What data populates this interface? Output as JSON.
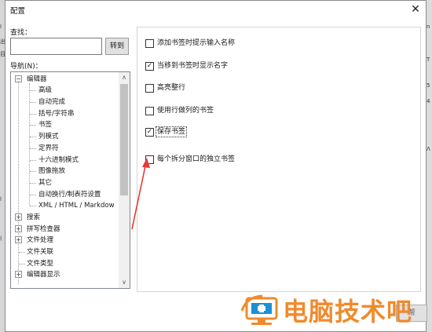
{
  "left_edge_fragments": [
    "Ⅰ",
    "出",
    "目",
    "l",
    "("
  ],
  "right_edge_fragments": [
    "n",
    "T",
    "5",
    "4",
    "ᐱ"
  ],
  "dialog": {
    "title": "配置",
    "close_glyph": "✕"
  },
  "find": {
    "label": "查找：",
    "value": "",
    "goto_label": "转到"
  },
  "nav": {
    "label": "导航(N)：",
    "items": [
      {
        "label": "编辑器",
        "level": 0,
        "expander": "−"
      },
      {
        "label": "高级",
        "level": 1
      },
      {
        "label": "自动完成",
        "level": 1
      },
      {
        "label": "括号/字符串",
        "level": 1
      },
      {
        "label": "书签",
        "level": 1
      },
      {
        "label": "列模式",
        "level": 1
      },
      {
        "label": "定界符",
        "level": 1
      },
      {
        "label": "十六进制模式",
        "level": 1
      },
      {
        "label": "图像拖放",
        "level": 1
      },
      {
        "label": "其它",
        "level": 1
      },
      {
        "label": "自动换行/制表符设置",
        "level": 1
      },
      {
        "label": "XML / HTML / Markdow",
        "level": 1
      },
      {
        "label": "搜索",
        "level": 0,
        "expander": "+"
      },
      {
        "label": "拼写检查器",
        "level": 0,
        "expander": "+"
      },
      {
        "label": "文件处理",
        "level": 0,
        "expander": "+"
      },
      {
        "label": "文件关联",
        "level": 0
      },
      {
        "label": "文件类型",
        "level": 0
      },
      {
        "label": "编辑器显示",
        "level": 0,
        "expander": "+"
      }
    ],
    "scroll_up_glyph": "∧",
    "scroll_down_glyph": "∨"
  },
  "options": [
    {
      "label": "添加书签时提示输入名称",
      "checked": false
    },
    {
      "label": "当移到书签时显示名字",
      "checked": true
    },
    {
      "label": "高亮整行",
      "checked": false
    },
    {
      "label": "使用行做列的书签",
      "checked": false
    },
    {
      "label": "保存书签",
      "checked": true,
      "focused": true
    },
    {
      "label": "每个拆分窗口的独立书签",
      "checked": false
    }
  ],
  "check_glyph": "✓",
  "bottom_button": {
    "label": "帮"
  },
  "watermark": {
    "text": "电脑技术吧",
    "color": "#f08a2c",
    "icon": "monitor-plus-icon"
  },
  "annotation": {
    "color": "#e53935"
  }
}
